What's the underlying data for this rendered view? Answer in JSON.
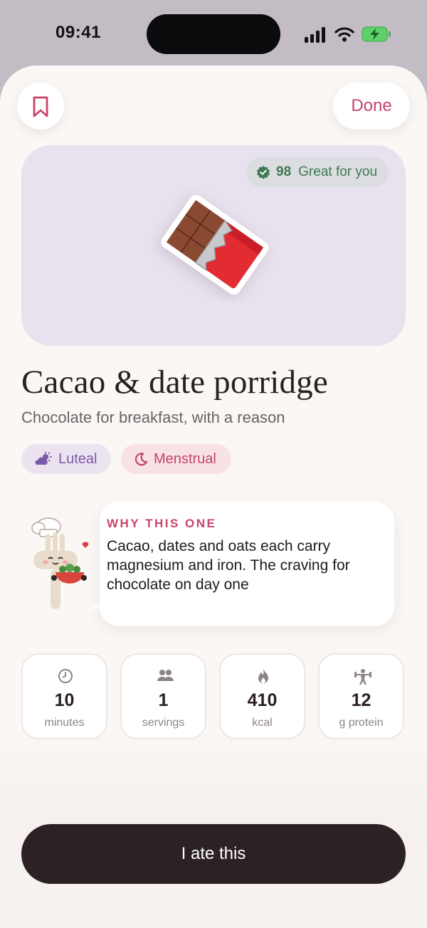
{
  "status_bar": {
    "time": "09:41"
  },
  "header": {
    "done_label": "Done"
  },
  "hero": {
    "score": "98",
    "score_label": "Great for you",
    "score_color": "#3f7a55"
  },
  "recipe": {
    "title": "Cacao & date porridge",
    "subtitle": "Chocolate for breakfast, with a reason"
  },
  "phases": [
    {
      "label": "Luteal",
      "icon": "cloud-sun-icon",
      "color": "#7a5aa6"
    },
    {
      "label": "Menstrual",
      "icon": "moon-icon",
      "color": "#c24466"
    }
  ],
  "why": {
    "heading": "WHY THIS ONE",
    "text": "Cacao, dates and oats each carry magnesium and iron. The craving for chocolate on day one"
  },
  "stats": [
    {
      "value": "10",
      "label": "minutes",
      "icon": "clock-icon"
    },
    {
      "value": "1",
      "label": "servings",
      "icon": "people-icon"
    },
    {
      "value": "410",
      "label": "kcal",
      "icon": "flame-icon"
    },
    {
      "value": "12",
      "label": "g protein",
      "icon": "weightlifter-icon"
    }
  ],
  "cta": {
    "label": "I ate this"
  },
  "colors": {
    "accent": "#c9446a",
    "cta_bg": "#2c2124",
    "hero_bg": "#e8e1ee"
  }
}
